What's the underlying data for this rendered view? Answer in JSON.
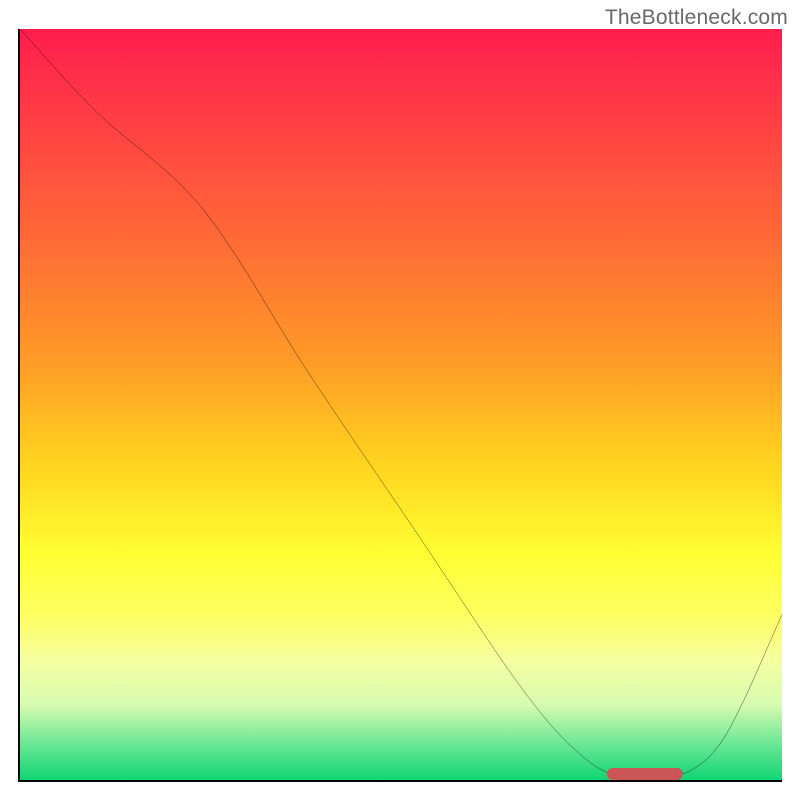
{
  "watermark": "TheBottleneck.com",
  "chart_data": {
    "type": "line",
    "title": "",
    "xlabel": "",
    "ylabel": "",
    "xlim": [
      0,
      100
    ],
    "ylim": [
      0,
      100
    ],
    "grid": false,
    "series": [
      {
        "name": "curve",
        "x": [
          0,
          10,
          24,
          38,
          52,
          66,
          74,
          80,
          85,
          92,
          100
        ],
        "y": [
          100,
          89,
          76,
          54,
          33,
          12,
          3,
          0,
          0,
          5,
          22
        ]
      }
    ],
    "marker": {
      "x_start": 77,
      "x_end": 87,
      "y": 0.8
    },
    "gradient_stops": [
      {
        "pos": 0.0,
        "color": "#ff1d4e"
      },
      {
        "pos": 0.12,
        "color": "#ff3e44"
      },
      {
        "pos": 0.28,
        "color": "#ff6a36"
      },
      {
        "pos": 0.44,
        "color": "#ff9a27"
      },
      {
        "pos": 0.58,
        "color": "#ffd41e"
      },
      {
        "pos": 0.7,
        "color": "#ffff33"
      },
      {
        "pos": 0.78,
        "color": "#feff60"
      },
      {
        "pos": 0.84,
        "color": "#f6ffa0"
      },
      {
        "pos": 0.9,
        "color": "#d6fbb0"
      },
      {
        "pos": 0.95,
        "color": "#6fe896"
      },
      {
        "pos": 1.0,
        "color": "#10d575"
      }
    ]
  }
}
